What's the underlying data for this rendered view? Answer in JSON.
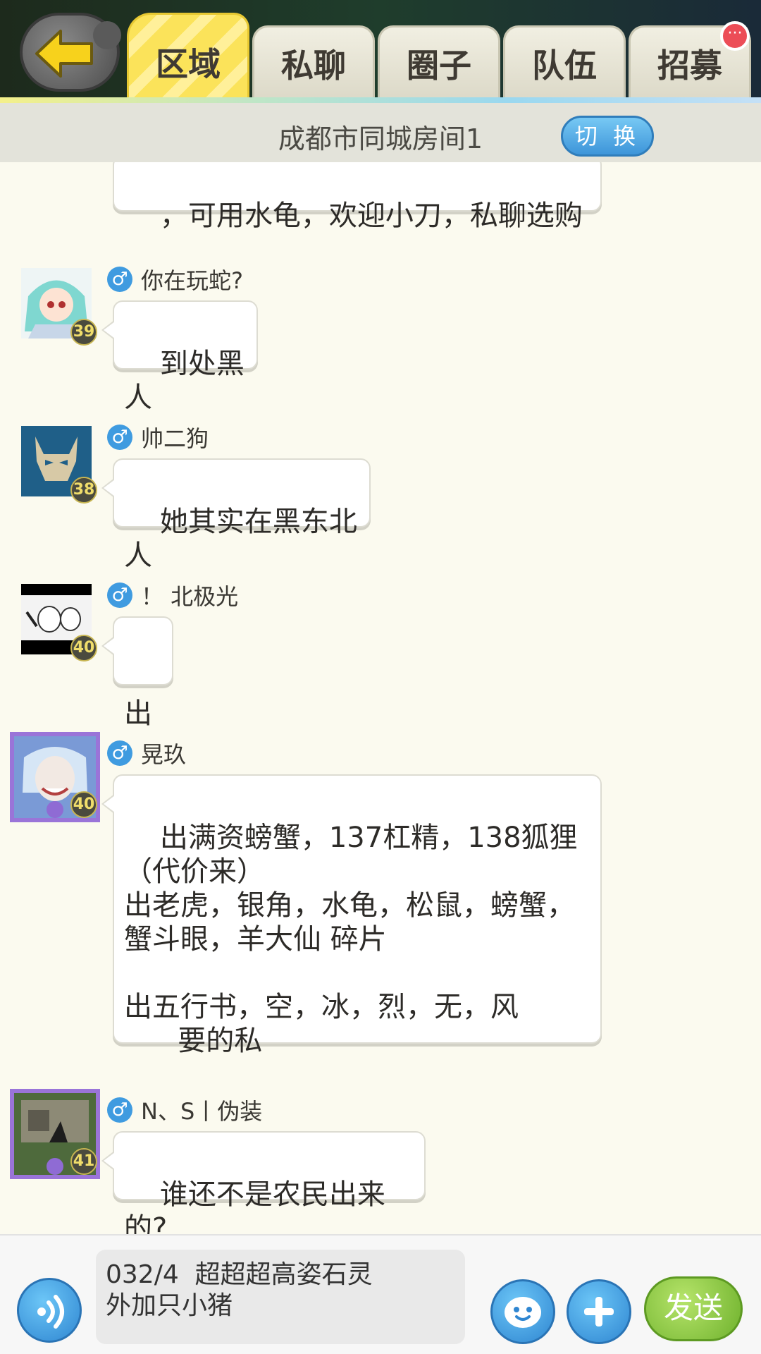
{
  "header": {
    "tabs": [
      {
        "label": "区域",
        "active": true
      },
      {
        "label": "私聊",
        "active": false
      },
      {
        "label": "圈子",
        "active": false
      },
      {
        "label": "队伍",
        "active": false
      },
      {
        "label": "招募",
        "active": false
      }
    ],
    "notification_badge": "···"
  },
  "room": {
    "title": "成都市同城房间1",
    "switch_label": "切 换"
  },
  "messages": [
    {
      "text": "，可用水龟，欢迎小刀，私聊选购"
    },
    {
      "sender": "你在玩蛇?",
      "level": "39",
      "text": "到处黑人"
    },
    {
      "sender": "帅二狗",
      "level": "38",
      "text": "她其实在黑东北人"
    },
    {
      "sender": "！ 北极光",
      "level": "40",
      "text": "出"
    },
    {
      "sender": "晃玖",
      "level": "40",
      "text": "出满资螃蟹，137杠精，138狐狸\n（代价来）\n出老虎，银角，水龟，松鼠，螃蟹，\n蟹斗眼，羊大仙 碎片\n\n出五行书，空，冰，烈，无，风\n      要的私"
    },
    {
      "sender": "N、S丨伪装",
      "level": "41",
      "text": "谁还不是农民出来的?"
    }
  ],
  "gender_symbol": "♂",
  "composer": {
    "input_value": "032/4  超超超高姿石灵\n外加只小猪",
    "send_label": "发送"
  },
  "colors": {
    "accent_blue": "#3d95d9",
    "send_green": "#6fb22d",
    "active_tab_yellow": "#fbe35a"
  }
}
